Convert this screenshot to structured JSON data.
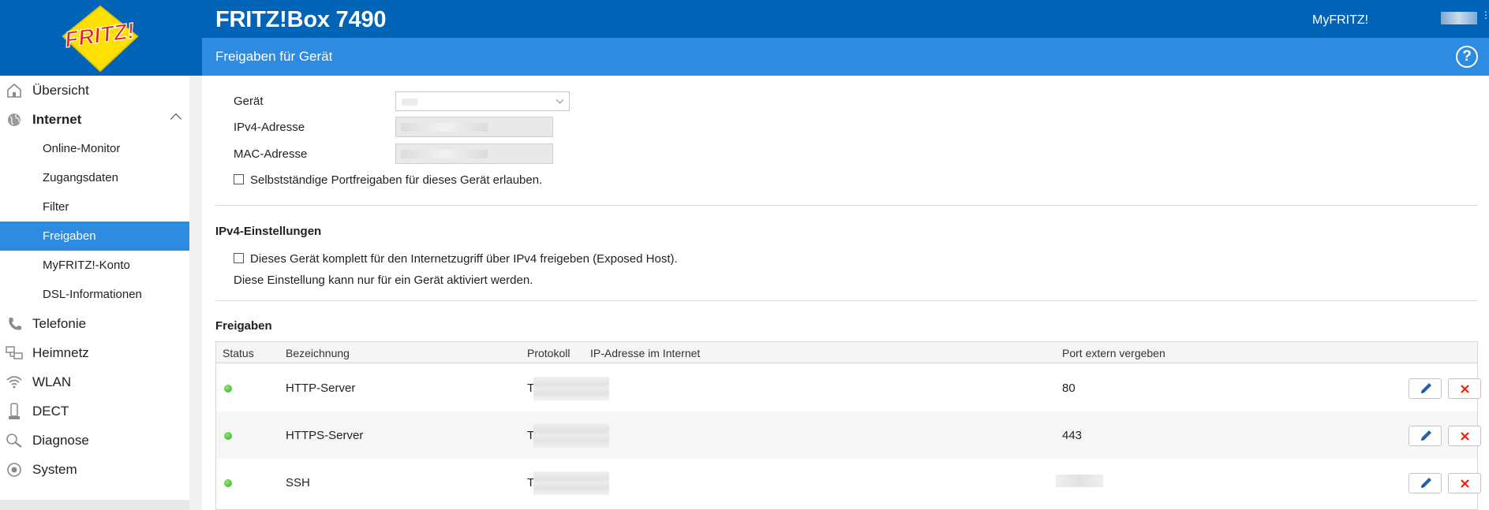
{
  "header": {
    "logo_text": "FRITZ!",
    "product": "FRITZ!Box 7490",
    "myfritz_link": "MyFRITZ!",
    "page_title": "Freigaben für Gerät",
    "help_symbol": "?"
  },
  "sidebar": {
    "items": [
      {
        "label": "Übersicht",
        "icon": "home-icon"
      },
      {
        "label": "Internet",
        "icon": "globe-icon",
        "expanded": true
      },
      {
        "label": "Online-Monitor"
      },
      {
        "label": "Zugangsdaten"
      },
      {
        "label": "Filter"
      },
      {
        "label": "Freigaben",
        "active": true
      },
      {
        "label": "MyFRITZ!-Konto"
      },
      {
        "label": "DSL-Informationen"
      },
      {
        "label": "Telefonie",
        "icon": "phone-icon"
      },
      {
        "label": "Heimnetz",
        "icon": "network-icon"
      },
      {
        "label": "WLAN",
        "icon": "wifi-icon"
      },
      {
        "label": "DECT",
        "icon": "dect-icon"
      },
      {
        "label": "Diagnose",
        "icon": "diagnose-icon"
      },
      {
        "label": "System",
        "icon": "system-icon"
      }
    ]
  },
  "device": {
    "geraet_label": "Gerät",
    "ipv4_label": "IPv4-Adresse",
    "mac_label": "MAC-Adresse",
    "auto_portshare_label": "Selbstständige Portfreigaben für dieses Gerät erlauben."
  },
  "ipv4": {
    "title": "IPv4-Einstellungen",
    "exposed_host_label": "Dieses Gerät komplett für den Internetzugriff über IPv4 freigeben (Exposed Host).",
    "note": "Diese Einstellung kann nur für ein Gerät aktiviert werden."
  },
  "freigaben": {
    "title": "Freigaben",
    "columns": [
      "Status",
      "Bezeichnung",
      "Protokoll",
      "IP-Adresse im Internet",
      "Port extern vergeben"
    ],
    "rows": [
      {
        "name": "HTTP-Server",
        "protocol": "TCP",
        "port": "80"
      },
      {
        "name": "HTTPS-Server",
        "protocol": "TCP",
        "port": "443"
      },
      {
        "name": "SSH",
        "protocol": "TCP",
        "port": ""
      }
    ]
  },
  "colors": {
    "header_blue": "#0264b6",
    "title_blue": "#2d8be2",
    "status_green": "#3cb832",
    "delete_red": "#e2231a",
    "edit_blue": "#2563a8"
  }
}
